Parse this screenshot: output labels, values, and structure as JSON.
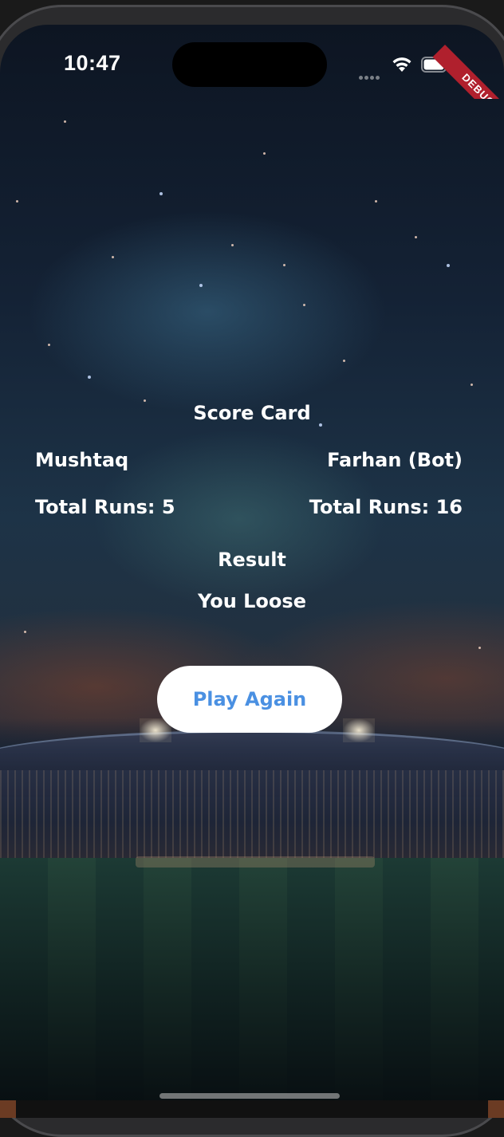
{
  "status_bar": {
    "time": "10:47",
    "debug_label": "DEBUG"
  },
  "scorecard": {
    "title": "Score Card",
    "player1": {
      "name": "Mushtaq",
      "runs_label": "Total Runs: 5"
    },
    "player2": {
      "name": "Farhan (Bot)",
      "runs_label": "Total Runs: 16"
    },
    "result_label": "Result",
    "result_value": "You Loose"
  },
  "actions": {
    "play_again_label": "Play Again"
  },
  "colors": {
    "button_text": "#4a90e2",
    "button_bg": "#ffffff",
    "debug_ribbon": "#b0202d"
  }
}
